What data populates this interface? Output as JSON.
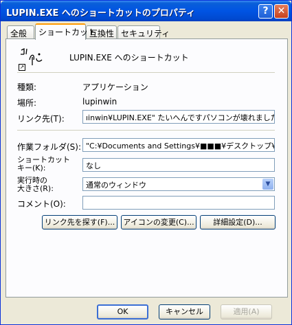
{
  "window": {
    "title": "LUPIN.EXE へのショートカットのプロパティ"
  },
  "titlebar_buttons": {
    "help": "?",
    "close": "✕"
  },
  "tabs": [
    {
      "label": "全般",
      "active": false
    },
    {
      "label": "ショートカット",
      "active": true
    },
    {
      "label": "互換性",
      "active": false
    },
    {
      "label": "セキュリティ",
      "active": false
    }
  ],
  "shortcut": {
    "name": "LUPIN.EXE へのショートカット",
    "type_label": "種類:",
    "type_value": "アプリケーション",
    "location_label": "場所:",
    "location_value": "lupinwin",
    "target_label": "リンク先(T):",
    "target_value": "ıinwin¥LUPIN.EXE\" たいへんですパソコンが壊れました！！",
    "startin_label": "作業フォルダ(S):",
    "startin_value": "\"C:¥Documents and Settings¥■■■¥デスクトップ¥lupir",
    "hotkey_label_1": "ショートカット",
    "hotkey_label_2": "キー(K):",
    "hotkey_value": "なし",
    "run_label_1": "実行時の",
    "run_label_2": "大きさ(R):",
    "run_value": "通常のウィンドウ",
    "comment_label": "コメント(O):",
    "comment_value": ""
  },
  "action_buttons": {
    "find_target": "リンク先を探す(F)...",
    "change_icon": "アイコンの変更(C)...",
    "advanced": "詳細設定(D)..."
  },
  "dialog_buttons": {
    "ok": "OK",
    "cancel": "キャンセル",
    "apply": "適用(A)"
  },
  "icons": {
    "shortcut_arrow": "↗",
    "dropdown": "▼"
  }
}
